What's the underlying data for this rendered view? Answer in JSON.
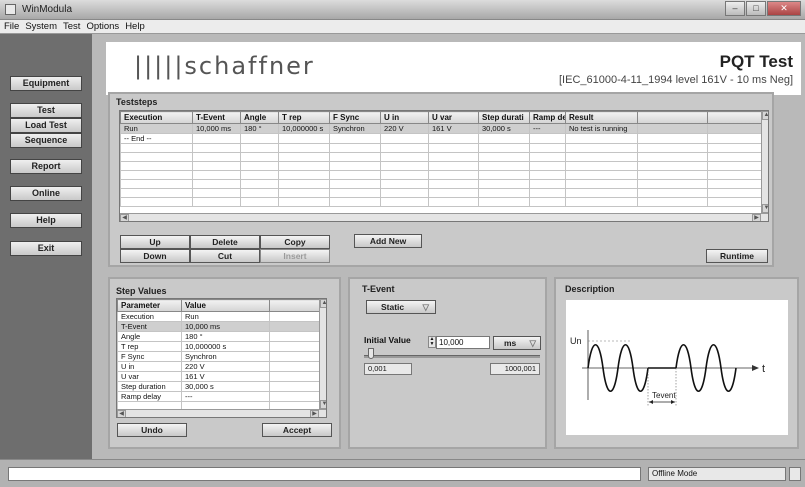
{
  "window": {
    "title": "WinModula"
  },
  "menu": [
    "File",
    "System",
    "Test",
    "Options",
    "Help"
  ],
  "nav": {
    "equipment": "Equipment",
    "test": "Test",
    "load_test": "Load Test",
    "sequence": "Sequence",
    "report": "Report",
    "online": "Online",
    "help": "Help",
    "exit": "Exit"
  },
  "header": {
    "logo": "|||||schaffner",
    "title": "PQT Test",
    "standard": "[IEC_61000-4-11_1994 level 161V - 10 ms Neg]"
  },
  "teststeps": {
    "title": "Teststeps",
    "columns": [
      "Execution",
      "T-Event",
      "Angle",
      "T rep",
      "F Sync",
      "U in",
      "U var",
      "Step durati",
      "Ramp dela",
      "Result",
      "",
      ""
    ],
    "rows": [
      [
        "Run",
        "10,000 ms",
        "180 °",
        "10,000000 s",
        "Synchron",
        "220 V",
        "161 V",
        "30,000 s",
        "---",
        "No test is running",
        "",
        ""
      ],
      [
        "-- End --",
        "",
        "",
        "",
        "",
        "",
        "",
        "",
        "",
        "",
        "",
        ""
      ]
    ],
    "buttons": {
      "up": "Up",
      "delete": "Delete",
      "copy": "Copy",
      "add_new": "Add New",
      "down": "Down",
      "cut": "Cut",
      "insert": "Insert",
      "runtime": "Runtime"
    }
  },
  "step_values": {
    "title": "Step Values",
    "columns": [
      "Parameter",
      "Value",
      ""
    ],
    "rows": [
      [
        "Execution",
        "Run"
      ],
      [
        "T-Event",
        "10,000 ms"
      ],
      [
        "Angle",
        "180 °"
      ],
      [
        "T rep",
        "10,000000 s"
      ],
      [
        "F Sync",
        "Synchron"
      ],
      [
        "U in",
        "220 V"
      ],
      [
        "U var",
        "161 V"
      ],
      [
        "Step duration",
        "30,000 s"
      ],
      [
        "Ramp delay",
        "---"
      ]
    ],
    "undo": "Undo",
    "accept": "Accept"
  },
  "tevent": {
    "title": "T-Event",
    "mode": "Static",
    "initial_label": "Initial Value",
    "initial_value": "10,000",
    "unit": "ms",
    "min": "0,001",
    "max": "1000,001"
  },
  "description": {
    "title": "Description",
    "un_label": "Un",
    "t_label": "t",
    "tevent_label": "Tevent"
  },
  "status": {
    "mode": "Offline Mode"
  }
}
